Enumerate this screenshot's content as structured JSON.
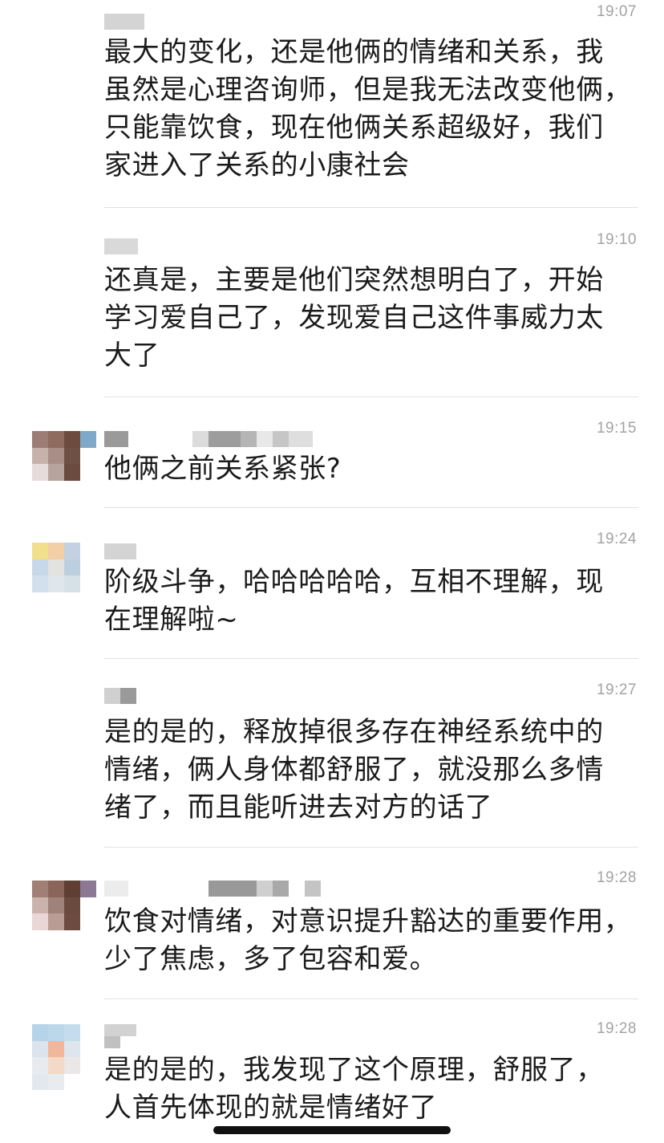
{
  "messages": [
    {
      "time": "19:07",
      "text": "最大的变化，还是他俩的情绪和关系，我\n虽然是心理咨询师，但是我无法改变他俩，\n只能靠饮食，现在他俩关系超级好，我们\n家进入了关系的小康社会"
    },
    {
      "time": "19:10",
      "text": "还真是，主要是他们突然想明白了，开始\n学习爱自己了，发现爱自己这件事威力太\n大了"
    },
    {
      "time": "19:15",
      "text": "他俩之前关系紧张?"
    },
    {
      "time": "19:24",
      "text": "阶级斗争，哈哈哈哈哈，互相不理解，现\n在理解啦~"
    },
    {
      "time": "19:27",
      "text": "是的是的，释放掉很多存在神经系统中的\n情绪，俩人身体都舒服了，就没那么多情\n绪了，而且能听进去对方的话了"
    },
    {
      "time": "19:28",
      "text": "饮食对情绪，对意识提升豁达的重要作用，\n少了焦虑，多了包容和爱。"
    },
    {
      "time": "19:28",
      "text": "是的是的，我发现了这个原理，舒服了，\n人首先体现的就是情绪好了"
    }
  ],
  "colors": {
    "text": "#1b1b1b",
    "timestamp": "#a3a3a3",
    "divider": "#e2e2e2",
    "background": "#ffffff",
    "home_indicator": "#111111"
  }
}
